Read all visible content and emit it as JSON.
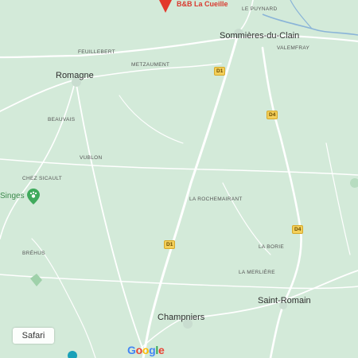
{
  "map": {
    "places": {
      "romagne": "Romagne",
      "sommieres": "Sommières-du-Clain",
      "champniers": "Champniers",
      "saint_romain": "Saint-Romain",
      "feuillebert": "FEUILLEBERT",
      "metzaument": "METZAUMENT",
      "le_puynard": "LE PUYNARD",
      "valemfray": "VALEMFRAY",
      "beauvais": "BEAUVAIS",
      "vublon": "VUBLON",
      "chez_sicault": "CHEZ SICAULT",
      "la_rochemairant": "LA ROCHEMAIRANT",
      "la_borie": "LA BORIE",
      "la_merliere": "LA MERLIÈRE",
      "brehus": "BRÉHUS",
      "singes": "Singes",
      "bb": "B&B La Cueille"
    },
    "roads": {
      "d1_a": "D1",
      "d1_b": "D1",
      "d4_a": "D4",
      "d4_b": "D4"
    },
    "attribution": "Google",
    "attribution_colors": [
      "#4285F4",
      "#EA4335",
      "#FBBC05",
      "#4285F4",
      "#34A853",
      "#EA4335"
    ],
    "colors": {
      "land": "#d3ead9",
      "road": "#ffffff",
      "river": "#8ab4d8",
      "marker": "#e2382b",
      "park": "#3faa5c"
    },
    "icons": {
      "marker": "map-pin-icon",
      "park": "paw-icon"
    }
  },
  "overlay": {
    "safari_button": "Safari"
  }
}
